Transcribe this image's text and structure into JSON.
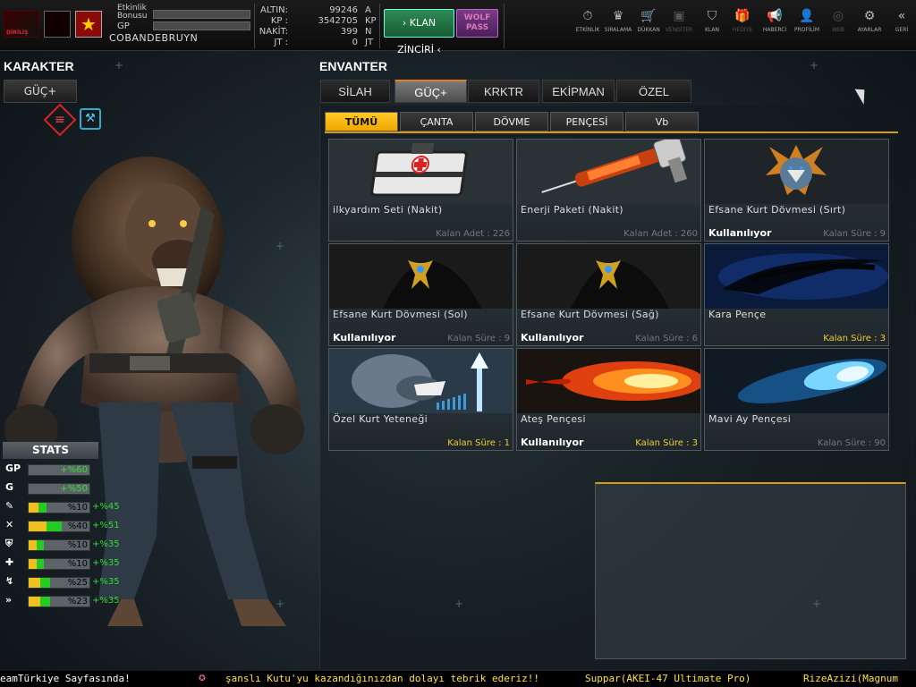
{
  "profile": {
    "bonus_label": "Etkinlik\nBonusu",
    "gp_label": "GP",
    "username": "COBANDEBRUYN",
    "logo_text": "DİRİLİŞ"
  },
  "currency": [
    {
      "label": "ALTIN:",
      "value": "99246",
      "unit": "A"
    },
    {
      "label": "KP :",
      "value": "3542705",
      "unit": "KP"
    },
    {
      "label": "NAKİT:",
      "value": "399",
      "unit": "N"
    },
    {
      "label": "JT :",
      "value": "0",
      "unit": "JT"
    }
  ],
  "buttons": {
    "klan": "› KLAN ZİNCİRİ ‹",
    "wolf": "WOLF\nPASS"
  },
  "nav": [
    {
      "label": "ETKİNLİK",
      "icon": "⏱",
      "dim": false
    },
    {
      "label": "SIRALAMA",
      "icon": "♛",
      "dim": false
    },
    {
      "label": "DÜKKAN",
      "icon": "🛒",
      "dim": false
    },
    {
      "label": "VENDİTER",
      "icon": "▣",
      "dim": true
    },
    {
      "label": "KLAN",
      "icon": "⛉",
      "dim": false
    },
    {
      "label": "HEDİYE",
      "icon": "🎁",
      "dim": true
    },
    {
      "label": "HABERCİ",
      "icon": "📢",
      "dim": false
    },
    {
      "label": "PROFİLİM",
      "icon": "👤",
      "dim": false
    },
    {
      "label": "WEB",
      "icon": "◎",
      "dim": true
    },
    {
      "label": "AYARLAR",
      "icon": "⚙",
      "dim": false
    },
    {
      "label": "GERİ",
      "icon": "«",
      "dim": false
    }
  ],
  "left": {
    "heading": "KARAKTER",
    "tab": "GÜÇ+",
    "stats_title": "STATS",
    "stats": [
      {
        "icon": "GP",
        "value": "+%60",
        "bonus": "",
        "fill": 0
      },
      {
        "icon": "G",
        "value": "+%50",
        "bonus": "",
        "fill": 0
      },
      {
        "icon": "✎",
        "value": "%10",
        "bonus": "+%45",
        "fill": 0.3
      },
      {
        "icon": "✕",
        "value": "%40",
        "bonus": "+%51",
        "fill": 0.55
      },
      {
        "icon": "⛨",
        "value": "%10",
        "bonus": "+%35",
        "fill": 0.25
      },
      {
        "icon": "✚",
        "value": "%10",
        "bonus": "+%35",
        "fill": 0.25
      },
      {
        "icon": "↯",
        "value": "%25",
        "bonus": "+%35",
        "fill": 0.35
      },
      {
        "icon": "»",
        "value": "%23",
        "bonus": "+%35",
        "fill": 0.35
      }
    ]
  },
  "inventory": {
    "heading": "ENVANTER",
    "tabs": [
      "SİLAH",
      "GÜÇ+",
      "KRKTR",
      "EKİPMAN",
      "ÖZEL"
    ],
    "active_tab": 1,
    "subtabs": [
      "TÜMÜ",
      "ÇANTA",
      "DÖVME",
      "PENÇESİ",
      "Vb"
    ],
    "active_subtab": 0,
    "items": [
      {
        "name": "ilkyardım Seti (Nakit)",
        "status": "",
        "remaining": "Kalan Adet : 226",
        "highlight": false,
        "art": "medkit"
      },
      {
        "name": "Enerji Paketi (Nakit)",
        "status": "",
        "remaining": "Kalan Adet : 260",
        "highlight": false,
        "art": "syringe"
      },
      {
        "name": "Efsane Kurt Dövmesi (Sırt)",
        "status": "Kullanılıyor",
        "remaining": "Kalan Süre : 9",
        "highlight": false,
        "art": "emblem"
      },
      {
        "name": "Efsane Kurt Dövmesi (Sol)",
        "status": "Kullanılıyor",
        "remaining": "Kalan Süre : 9",
        "highlight": false,
        "art": "tattoo"
      },
      {
        "name": "Efsane Kurt Dövmesi (Sağ)",
        "status": "Kullanılıyor",
        "remaining": "Kalan Süre : 6",
        "highlight": false,
        "art": "tattoo"
      },
      {
        "name": "Kara Pençe",
        "status": "",
        "remaining": "Kalan Süre : 3",
        "highlight": true,
        "art": "darkclaw"
      },
      {
        "name": "Özel Kurt Yeteneği",
        "status": "",
        "remaining": "Kalan Süre : 1",
        "highlight": true,
        "art": "wolf"
      },
      {
        "name": "Ateş Pençesi",
        "status": "Kullanılıyor",
        "remaining": "Kalan Süre : 3",
        "highlight": true,
        "art": "fire"
      },
      {
        "name": "Mavi Ay Pençesi",
        "status": "",
        "remaining": "Kalan Süre : 90",
        "highlight": false,
        "art": "blue"
      }
    ]
  },
  "ticker": [
    {
      "text": "eamTürkiye Sayfasında!",
      "color": "#ffffff"
    },
    {
      "text": "şanslı Kutu'yu kazandığınızdan dolayı tebrik ederiz!!",
      "color": "#ffe040"
    },
    {
      "text": "Suppar(AKEI-47 Ultimate Pro)",
      "color": "#ffe040"
    },
    {
      "text": "RizeAzizi(Magnum",
      "color": "#ffe040"
    }
  ],
  "colors": {
    "accent": "#d89a10",
    "tab_active": "#ffc928",
    "bonus_green": "#33dd33"
  }
}
